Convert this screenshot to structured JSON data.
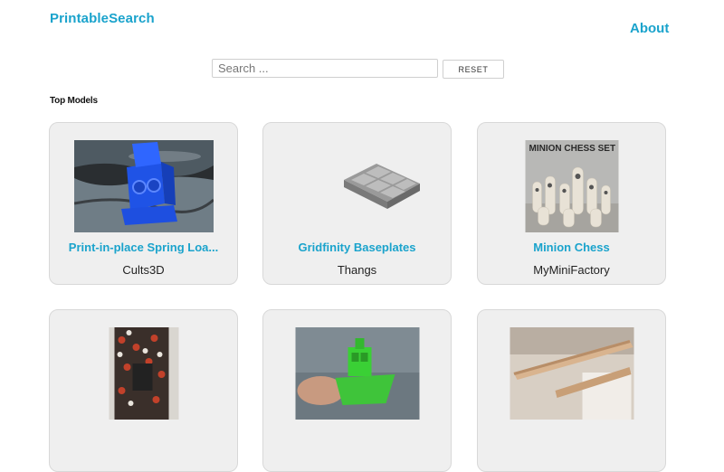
{
  "header": {
    "brand": "PrintableSearch",
    "about": "About"
  },
  "search": {
    "placeholder": "Search ...",
    "value": "",
    "reset_label": "RESET"
  },
  "section": {
    "heading": "Top Models"
  },
  "cards": [
    {
      "title": "Print-in-place Spring Loa...",
      "source": "Cults3D",
      "image": "blue-hinged-box-photo"
    },
    {
      "title": "Gridfinity Baseplates",
      "source": "Thangs",
      "image": "gridfinity-baseplate-render"
    },
    {
      "title": "Minion Chess",
      "source": "MyMiniFactory",
      "image": "minion-chess-set-render",
      "image_text": "MINION CHESS SET"
    },
    {
      "title": "",
      "source": "",
      "image": "hexagon-pegboard-photo"
    },
    {
      "title": "",
      "source": "",
      "image": "green-benchy-boat-photo"
    },
    {
      "title": "",
      "source": "",
      "image": "wooden-rods-photo"
    }
  ]
}
